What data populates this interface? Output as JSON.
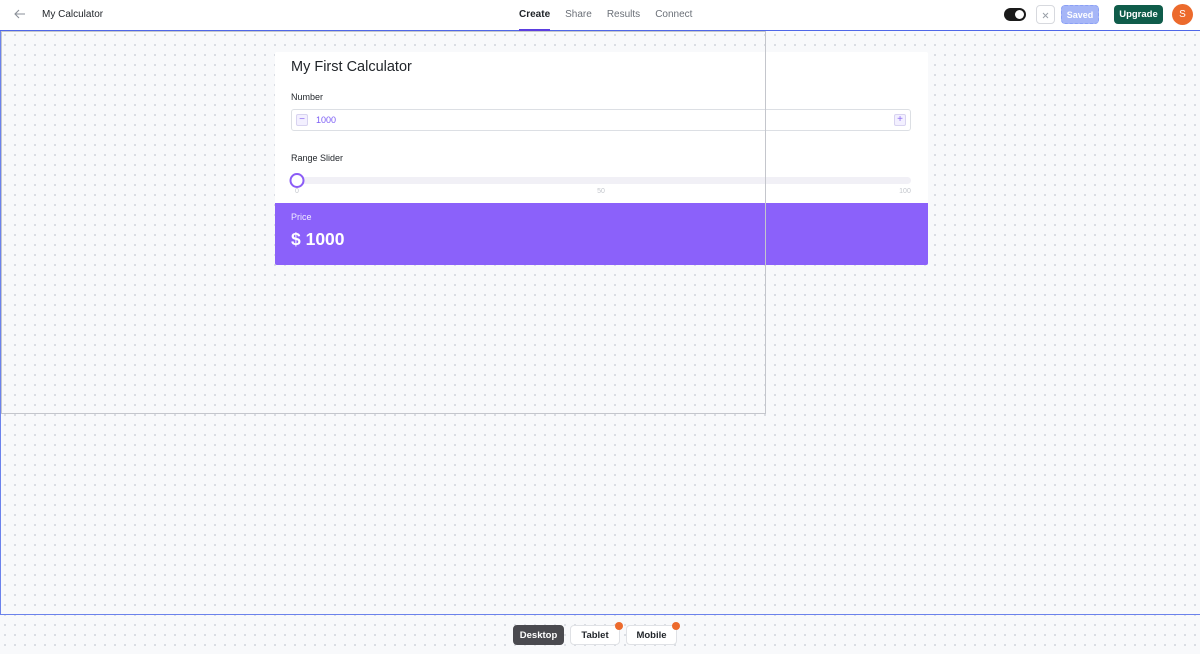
{
  "header": {
    "back_icon": "arrow-left-icon",
    "title": "My Calculator",
    "tabs": [
      {
        "label": "Create",
        "active": true
      },
      {
        "label": "Share",
        "active": false
      },
      {
        "label": "Results",
        "active": false
      },
      {
        "label": "Connect",
        "active": false
      }
    ],
    "toggle_on": true,
    "close_icon": "close-icon",
    "saved_label": "Saved",
    "upgrade_label": "Upgrade",
    "avatar_initial": "S"
  },
  "calculator": {
    "title": "My First Calculator",
    "number_field": {
      "label": "Number",
      "value": "1000",
      "minus_symbol": "−",
      "plus_symbol": "+"
    },
    "range_slider": {
      "label": "Range Slider",
      "value": 0,
      "min": 0,
      "max": 100,
      "ticks": [
        "0",
        "50",
        "100"
      ]
    },
    "result": {
      "label": "Price",
      "value": "$ 1000"
    }
  },
  "device_switcher": {
    "options": [
      {
        "label": "Desktop",
        "active": true,
        "badge": false
      },
      {
        "label": "Tablet",
        "active": false,
        "badge": true
      },
      {
        "label": "Mobile",
        "active": false,
        "badge": true
      }
    ]
  },
  "colors": {
    "accent": "#8b61fa",
    "brand_dark": "#0f5c4a",
    "badge": "#ec6a2c",
    "selection": "#4f67e8"
  }
}
